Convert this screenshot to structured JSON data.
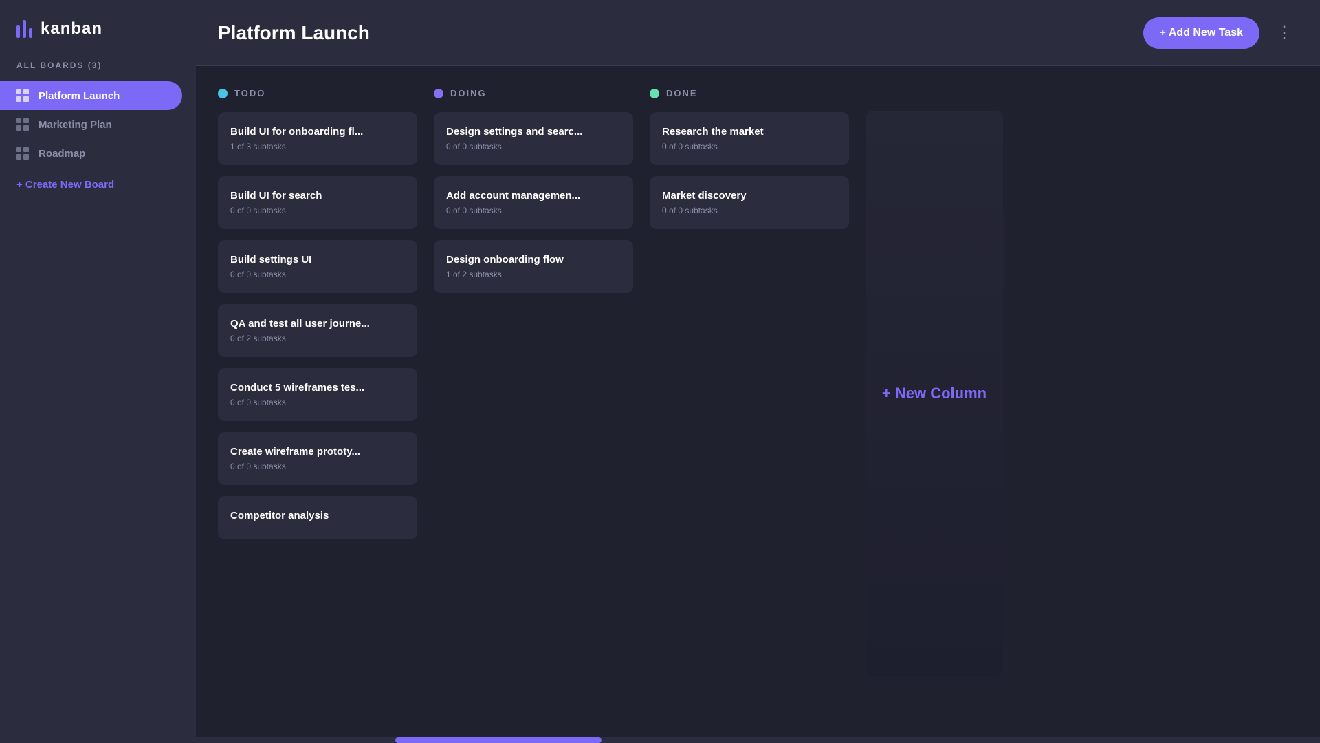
{
  "sidebar": {
    "logo_text": "kanban",
    "boards_label": "All Boards (3)",
    "boards": [
      {
        "id": "platform-launch",
        "label": "Platform Launch",
        "active": true
      },
      {
        "id": "marketing-plan",
        "label": "Marketing Plan",
        "active": false
      },
      {
        "id": "roadmap",
        "label": "Roadmap",
        "active": false
      }
    ],
    "create_board_label": "+ Create New Board"
  },
  "header": {
    "title": "Platform Launch",
    "add_task_label": "+ Add New Task",
    "menu_icon": "⋮"
  },
  "board": {
    "columns": [
      {
        "id": "todo",
        "title": "Todo",
        "dot_color": "#49c4e5",
        "tasks": [
          {
            "id": "t1",
            "title": "Build UI for onboarding fl...",
            "subtasks": "1 of 3 subtasks"
          },
          {
            "id": "t2",
            "title": "Build UI for search",
            "subtasks": "0 of 0 subtasks"
          },
          {
            "id": "t3",
            "title": "Build settings UI",
            "subtasks": "0 of 0 subtasks"
          },
          {
            "id": "t4",
            "title": "QA and test all user journe...",
            "subtasks": "0 of 2 subtasks"
          },
          {
            "id": "t5",
            "title": "Conduct 5 wireframes tes...",
            "subtasks": "0 of 0 subtasks"
          },
          {
            "id": "t6",
            "title": "Create wireframe prototy...",
            "subtasks": "0 of 0 subtasks"
          },
          {
            "id": "t7",
            "title": "Competitor analysis",
            "subtasks": ""
          }
        ]
      },
      {
        "id": "doing",
        "title": "Doing",
        "dot_color": "#8471f2",
        "tasks": [
          {
            "id": "d1",
            "title": "Design settings and searc...",
            "subtasks": "0 of 0 subtasks"
          },
          {
            "id": "d2",
            "title": "Add account managemen...",
            "subtasks": "0 of 0 subtasks"
          },
          {
            "id": "d3",
            "title": "Design onboarding flow",
            "subtasks": "1 of 2 subtasks"
          }
        ]
      },
      {
        "id": "done",
        "title": "Done",
        "dot_color": "#67e2ae",
        "tasks": [
          {
            "id": "dn1",
            "title": "Research the market",
            "subtasks": "0 of 0 subtasks"
          },
          {
            "id": "dn2",
            "title": "Market discovery",
            "subtasks": "0 of 0 subtasks"
          }
        ]
      }
    ],
    "new_column_label": "+ New Column"
  }
}
